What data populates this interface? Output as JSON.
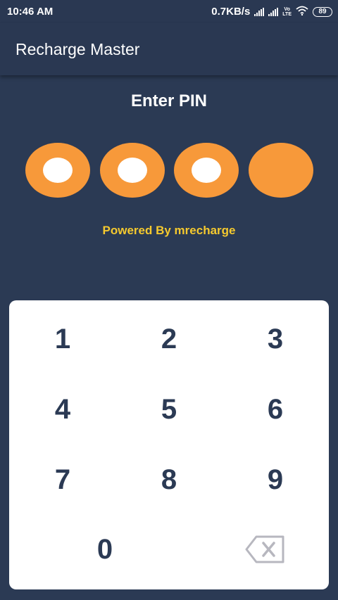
{
  "status_bar": {
    "time": "10:46 AM",
    "network_speed": "0.7KB/s",
    "volte_label_top": "Vo",
    "volte_label_bottom": "LTE",
    "battery": "89",
    "icons": [
      "signal-icon",
      "signal-icon",
      "volte-icon",
      "wifi-icon",
      "battery-icon"
    ]
  },
  "app_bar": {
    "title": "Recharge Master"
  },
  "pin": {
    "title": "Enter PIN",
    "length": 4,
    "filled": 3,
    "colors": {
      "dot": "#f7993a",
      "filled_inner": "#ffffff"
    }
  },
  "powered_by": "Powered By mrecharge",
  "keypad": {
    "keys": [
      "1",
      "2",
      "3",
      "4",
      "5",
      "6",
      "7",
      "8",
      "9",
      "0"
    ],
    "backspace_icon": "backspace-icon"
  },
  "colors": {
    "background": "#2b3a54",
    "accent": "#f7993a",
    "powered_text": "#f5c92e",
    "key_text": "#2b3a54"
  }
}
